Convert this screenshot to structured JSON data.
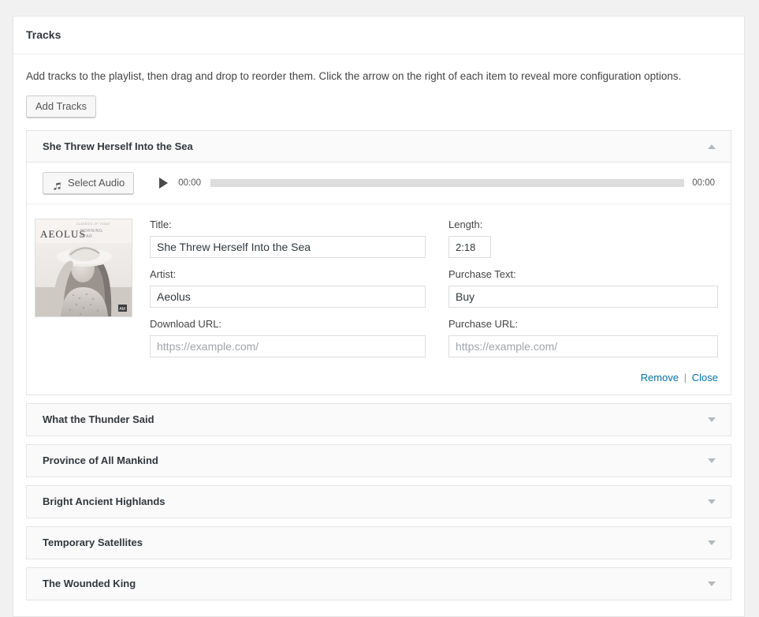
{
  "metabox": {
    "title": "Tracks",
    "intro": "Add tracks to the playlist, then drag and drop to reorder them. Click the arrow on the right of each item to reveal more configuration options.",
    "add_tracks_label": "Add Tracks"
  },
  "icons": {
    "note": "music-note-icon",
    "play": "play-icon",
    "collapse": "triangle-up-icon",
    "expand": "triangle-down-icon"
  },
  "colors": {
    "link": "#0073aa",
    "panel_border": "#e5e5e5",
    "header_bg": "#fafafa",
    "page_bg": "#f1f1f1",
    "rail": "#dddddd"
  },
  "expanded_track": {
    "name": "She Threw Herself Into the Sea",
    "select_audio_label": "Select Audio",
    "player": {
      "current_time": "00:00",
      "duration": "00:00",
      "progress_percent": 0
    },
    "artwork": {
      "artist_text": "AEOLUS",
      "album_text": "MORNING STAR",
      "top_caption": "CLASSICS OF TODAY"
    },
    "fields": {
      "title_label": "Title:",
      "title_value": "She Threw Herself Into the Sea",
      "title_placeholder": "",
      "artist_label": "Artist:",
      "artist_value": "Aeolus",
      "artist_placeholder": "",
      "download_url_label": "Download URL:",
      "download_url_value": "",
      "download_url_placeholder": "https://example.com/",
      "length_label": "Length:",
      "length_value": "2:18",
      "length_placeholder": "",
      "purchase_text_label": "Purchase Text:",
      "purchase_text_value": "Buy",
      "purchase_text_placeholder": "",
      "purchase_url_label": "Purchase URL:",
      "purchase_url_value": "",
      "purchase_url_placeholder": "https://example.com/"
    },
    "actions": {
      "remove_label": "Remove",
      "separator": "|",
      "close_label": "Close"
    }
  },
  "collapsed_tracks": [
    {
      "name": "What the Thunder Said"
    },
    {
      "name": "Province of All Mankind"
    },
    {
      "name": "Bright Ancient Highlands"
    },
    {
      "name": "Temporary Satellites"
    },
    {
      "name": "The Wounded King"
    }
  ]
}
